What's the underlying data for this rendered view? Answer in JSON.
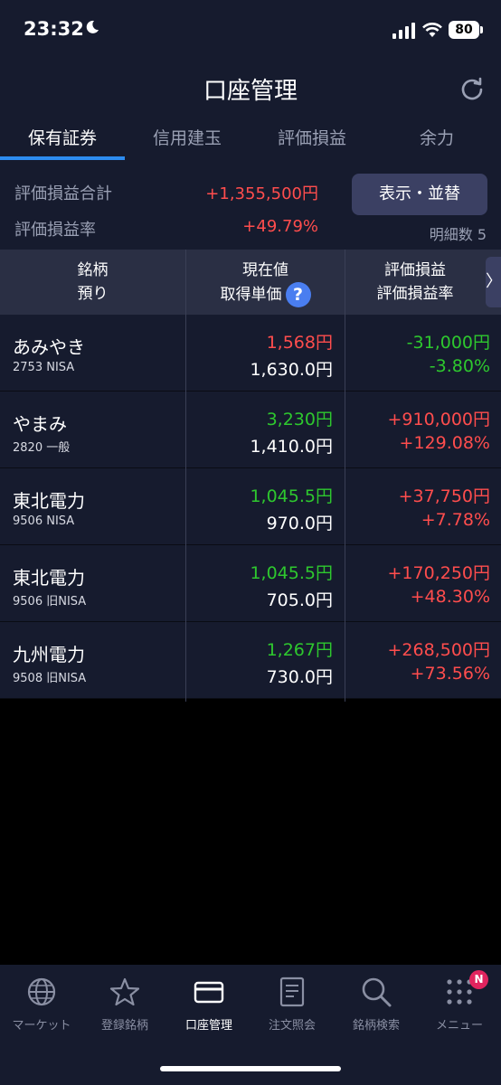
{
  "status": {
    "time": "23:32",
    "battery": "80"
  },
  "header": {
    "title": "口座管理"
  },
  "tabs": [
    {
      "label": "保有証券",
      "active": true
    },
    {
      "label": "信用建玉",
      "active": false
    },
    {
      "label": "評価損益",
      "active": false
    },
    {
      "label": "余力",
      "active": false
    }
  ],
  "summary": {
    "total_label": "評価損益合計",
    "total_value": "+1,355,500円",
    "rate_label": "評価損益率",
    "rate_value": "+49.79%",
    "sort_button": "表示・並替",
    "count_label": "明細数",
    "count_value": "5"
  },
  "table": {
    "head": {
      "col1_line1": "銘柄",
      "col1_line2": "預り",
      "col2_line1": "現在値",
      "col2_line2": "取得単価",
      "col3_line1": "評価損益",
      "col3_line2": "評価損益率",
      "help": "?",
      "next": "〉"
    },
    "rows": [
      {
        "name": "あみやき",
        "code": "2753 NISA",
        "price": "1,568円",
        "price_color": "red",
        "cost": "1,630.0円",
        "pl": "-31,000円",
        "pl_rate": "-3.80%",
        "pl_color": "green"
      },
      {
        "name": "やまみ",
        "code": "2820 一般",
        "price": "3,230円",
        "price_color": "green",
        "cost": "1,410.0円",
        "pl": "+910,000円",
        "pl_rate": "+129.08%",
        "pl_color": "red"
      },
      {
        "name": "東北電力",
        "code": "9506 NISA",
        "price": "1,045.5円",
        "price_color": "green",
        "cost": "970.0円",
        "pl": "+37,750円",
        "pl_rate": "+7.78%",
        "pl_color": "red"
      },
      {
        "name": "東北電力",
        "code": "9506 旧NISA",
        "price": "1,045.5円",
        "price_color": "green",
        "cost": "705.0円",
        "pl": "+170,250円",
        "pl_rate": "+48.30%",
        "pl_color": "red"
      },
      {
        "name": "九州電力",
        "code": "9508 旧NISA",
        "price": "1,267円",
        "price_color": "green",
        "cost": "730.0円",
        "pl": "+268,500円",
        "pl_rate": "+73.56%",
        "pl_color": "red"
      }
    ]
  },
  "bottom_nav": {
    "items": [
      {
        "label": "マーケット",
        "icon": "globe-icon"
      },
      {
        "label": "登録銘柄",
        "icon": "star-icon"
      },
      {
        "label": "口座管理",
        "icon": "card-icon",
        "active": true
      },
      {
        "label": "注文照会",
        "icon": "document-icon"
      },
      {
        "label": "銘柄検索",
        "icon": "search-icon"
      },
      {
        "label": "メニュー",
        "icon": "grid-menu-icon"
      }
    ],
    "badge": "N"
  },
  "colors": {
    "background": "#161b2e",
    "accent": "#2d8cf0",
    "positive": "#ff4d4d",
    "negative": "#2ec82e",
    "button": "#3b4063"
  }
}
